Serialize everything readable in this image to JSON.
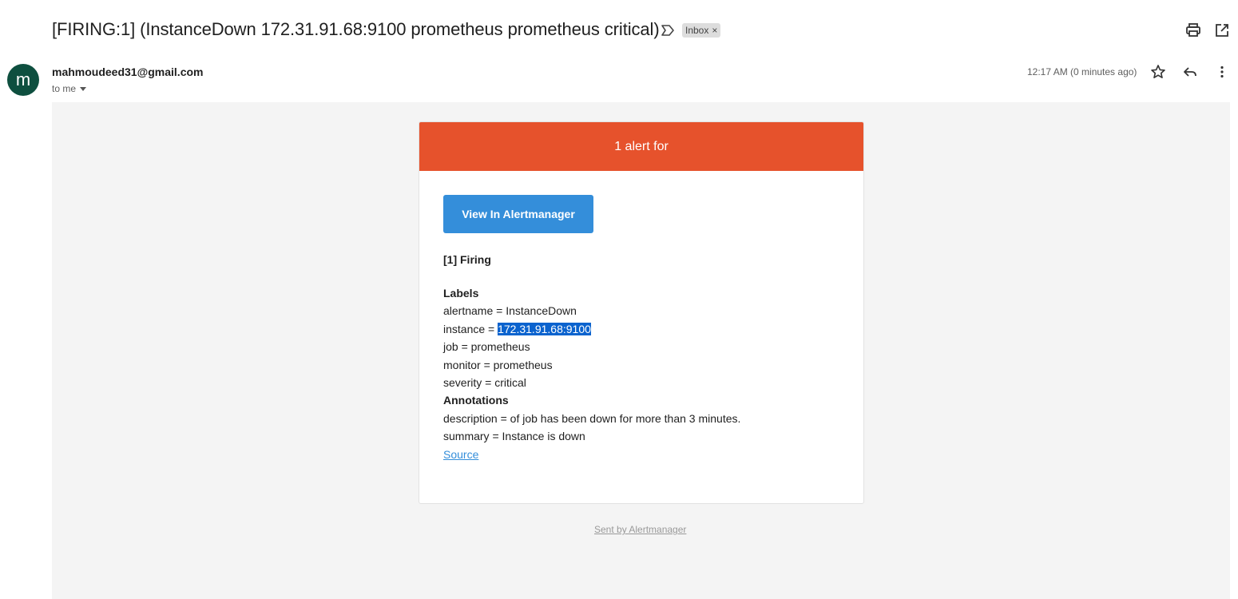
{
  "email": {
    "subject": "[FIRING:1] (InstanceDown 172.31.91.68:9100 prometheus prometheus critical)",
    "label_chip": "Inbox",
    "label_chip_remove": "×",
    "sender_initial": "m",
    "sender": "mahmoudeed31@gmail.com",
    "recipient": "to me",
    "timestamp": "12:17 AM (0 minutes ago)"
  },
  "icons": {
    "important": "label-important-icon",
    "print": "print-icon",
    "open_new_window": "open-in-new-icon",
    "star": "star-icon",
    "reply": "reply-icon",
    "more": "more-vert-icon",
    "recipient_dropdown": "chevron-down-icon"
  },
  "alert": {
    "header": "1 alert for",
    "button": "View In Alertmanager",
    "firing": "[1] Firing",
    "labels_heading": "Labels",
    "labels": {
      "alertname": "alertname = InstanceDown",
      "instance_prefix": "instance = ",
      "instance_value": "172.31.91.68:9100",
      "job": "job = prometheus",
      "monitor": "monitor = prometheus",
      "severity": "severity = critical"
    },
    "annotations_heading": "Annotations",
    "annotations": {
      "description": "description = of job has been down for more than 3 minutes.",
      "summary": "summary = Instance is down"
    },
    "source_link": "Source",
    "footer": "Sent by Alertmanager"
  },
  "colors": {
    "header_bg": "#e6522c",
    "button_bg": "#348eda",
    "avatar_bg": "#0e4f3f",
    "selection": "#0b63ce"
  }
}
